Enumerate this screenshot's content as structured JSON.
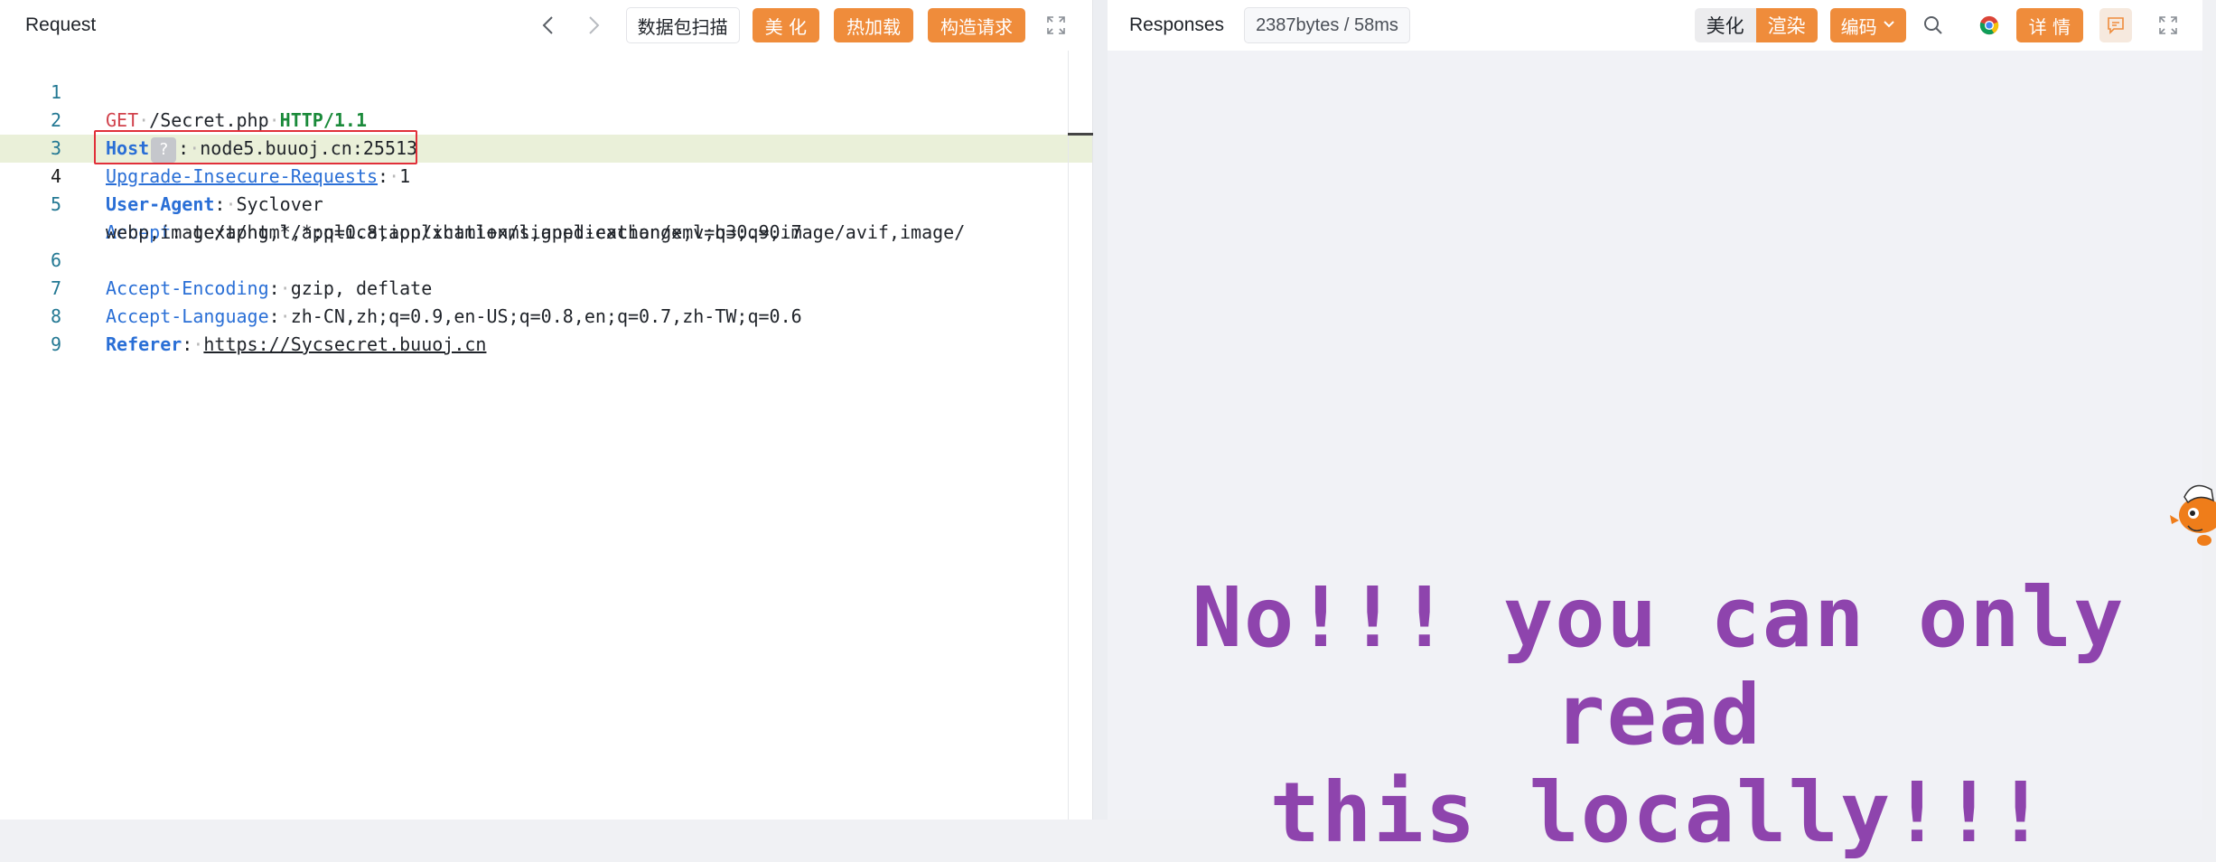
{
  "request": {
    "title": "Request",
    "buttons": {
      "scan": "数据包扫描",
      "beautify": "美 化",
      "hotload": "热加载",
      "construct": "构造请求"
    },
    "lines": [
      {
        "n": "1",
        "method": "GET",
        "path": "/Secret.php",
        "protocol": "HTTP/1.1"
      },
      {
        "n": "2",
        "key": "Host",
        "badge": "?",
        "value": "node5.buuoj.cn:25513"
      },
      {
        "n": "3",
        "key": "Upgrade-Insecure-Requests",
        "value": "1"
      },
      {
        "n": "4",
        "key": "User-Agent",
        "value": "Syclover"
      },
      {
        "n": "5",
        "key": "Accept",
        "value": "text/html,application/xhtml+xml,application/xml;q=0.9,image/avif,image/",
        "value2": "webp,image/apng,*/*;q=0.8,application/signed-exchange;v=b3;q=0.7"
      },
      {
        "n": "6",
        "key": "Accept-Encoding",
        "value": "gzip, deflate"
      },
      {
        "n": "7",
        "key": "Accept-Language",
        "value": "zh-CN,zh;q=0.9,en-US;q=0.8,en;q=0.7,zh-TW;q=0.6"
      },
      {
        "n": "8",
        "key": "Referer",
        "value": "https://Sycsecret.buuoj.cn"
      },
      {
        "n": "9"
      }
    ]
  },
  "response": {
    "title": "Responses",
    "size": "2387bytes / 58ms",
    "buttons": {
      "beautify": "美化",
      "render": "渲染",
      "encode": "编码",
      "detail": "详 情"
    },
    "message_line1": "No!!! you can only read",
    "message_line2": "this locally!!!"
  },
  "colors": {
    "accent": "#ef8c3b",
    "message": "#8e44ad",
    "highlight_box": "#e1303a"
  }
}
